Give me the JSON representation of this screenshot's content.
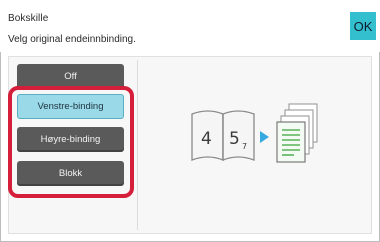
{
  "header": {
    "title": "Bokskille",
    "subtitle": "Velg original endeinnbinding.",
    "ok_label": "OK"
  },
  "options": [
    {
      "label": "Off",
      "selected": false
    },
    {
      "label": "Venstre-binding",
      "selected": true
    },
    {
      "label": "Høyre-binding",
      "selected": false
    },
    {
      "label": "Blokk",
      "selected": false
    }
  ],
  "illustration": {
    "page_numbers": [
      "4",
      "5",
      "7"
    ],
    "icons": [
      "open-book-icon",
      "arrow-right-icon",
      "document-stack-icon"
    ]
  },
  "colors": {
    "accent": "#34bfcf",
    "selected_button": "#9ad9e7",
    "button": "#5a5a5a",
    "highlight": "#d41e3a"
  }
}
